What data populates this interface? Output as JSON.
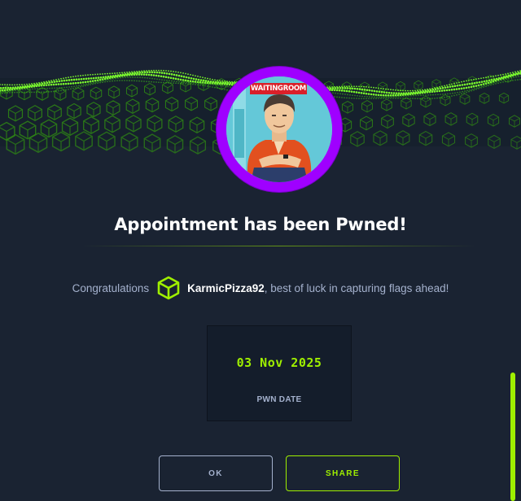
{
  "banner": {
    "avatar_sign_text": "WAITINGROOM",
    "ring_color": "#9f00ff"
  },
  "title": "Appointment has been Pwned!",
  "congrats": {
    "prefix": "Congratulations",
    "user_icon": "cube-icon",
    "username": "KarmicPizza92",
    "suffix": ", best of luck in capturing flags ahead!"
  },
  "pwn_date": {
    "value": "03 Nov 2025",
    "label": "PWN DATE"
  },
  "buttons": {
    "ok_label": "OK",
    "share_label": "SHARE"
  },
  "colors": {
    "accent": "#9fef00",
    "background": "#1a2332",
    "muted_text": "#a4b1cd"
  }
}
